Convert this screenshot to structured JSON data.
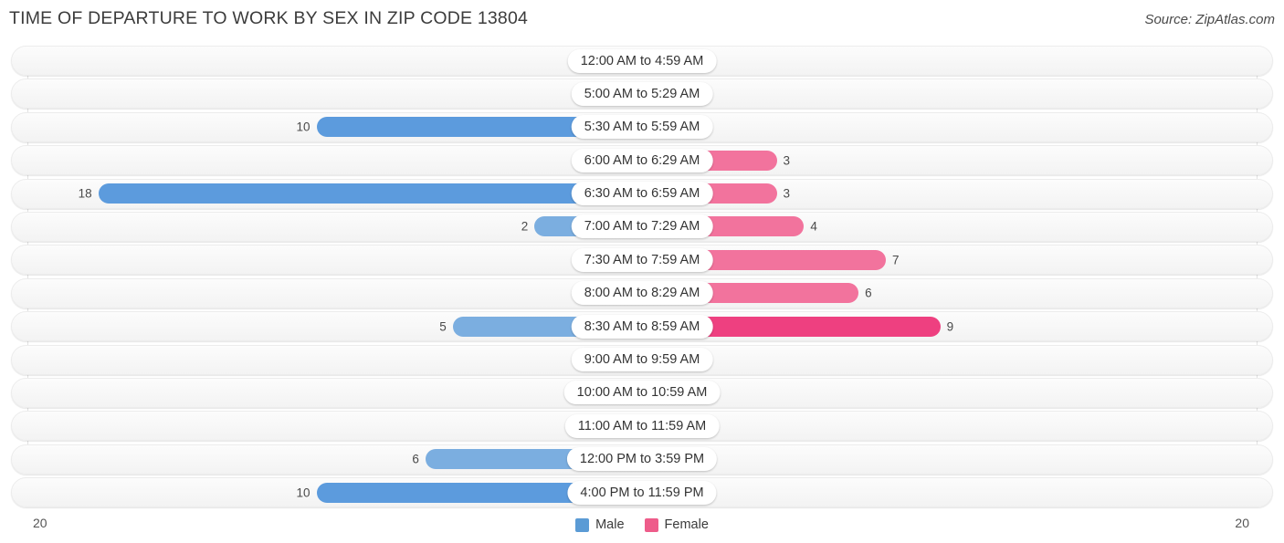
{
  "header": {
    "title": "TIME OF DEPARTURE TO WORK BY SEX IN ZIP CODE 13804",
    "source": "Source: ZipAtlas.com"
  },
  "axis": {
    "left_label": "20",
    "right_label": "20"
  },
  "legend": {
    "items": [
      {
        "label": "Male",
        "color": "#5B9BD5"
      },
      {
        "label": "Female",
        "color": "#EE5C8A"
      }
    ]
  },
  "colors": {
    "male_strong": "#5C9BDD",
    "male_mid": "#7BAEE0",
    "male_light": "#AECBEC",
    "female_strong": "#EE4080",
    "female_mid": "#F2739D",
    "female_light": "#F8AEC8",
    "row_track": "#f5f5f5",
    "gridline": "#e2e2e2"
  },
  "chart_data": {
    "type": "bar",
    "title": "TIME OF DEPARTURE TO WORK BY SEX IN ZIP CODE 13804",
    "subtitle": "Source: ZipAtlas.com",
    "orientation": "horizontal-diverging",
    "xlabel": "",
    "ylabel": "",
    "xlim": [
      0,
      20
    ],
    "grid": false,
    "legend_position": "bottom-center",
    "categories": [
      "12:00 AM to 4:59 AM",
      "5:00 AM to 5:29 AM",
      "5:30 AM to 5:59 AM",
      "6:00 AM to 6:29 AM",
      "6:30 AM to 6:59 AM",
      "7:00 AM to 7:29 AM",
      "7:30 AM to 7:59 AM",
      "8:00 AM to 8:29 AM",
      "8:30 AM to 8:59 AM",
      "9:00 AM to 9:59 AM",
      "10:00 AM to 10:59 AM",
      "11:00 AM to 11:59 AM",
      "12:00 PM to 3:59 PM",
      "4:00 PM to 11:59 PM"
    ],
    "series": [
      {
        "name": "Male",
        "side": "left",
        "values": [
          0,
          0,
          10,
          0,
          18,
          2,
          0,
          0,
          5,
          0,
          0,
          0,
          6,
          10
        ]
      },
      {
        "name": "Female",
        "side": "right",
        "values": [
          0,
          0,
          0,
          3,
          3,
          4,
          7,
          6,
          9,
          0,
          0,
          0,
          0,
          0
        ]
      }
    ]
  }
}
